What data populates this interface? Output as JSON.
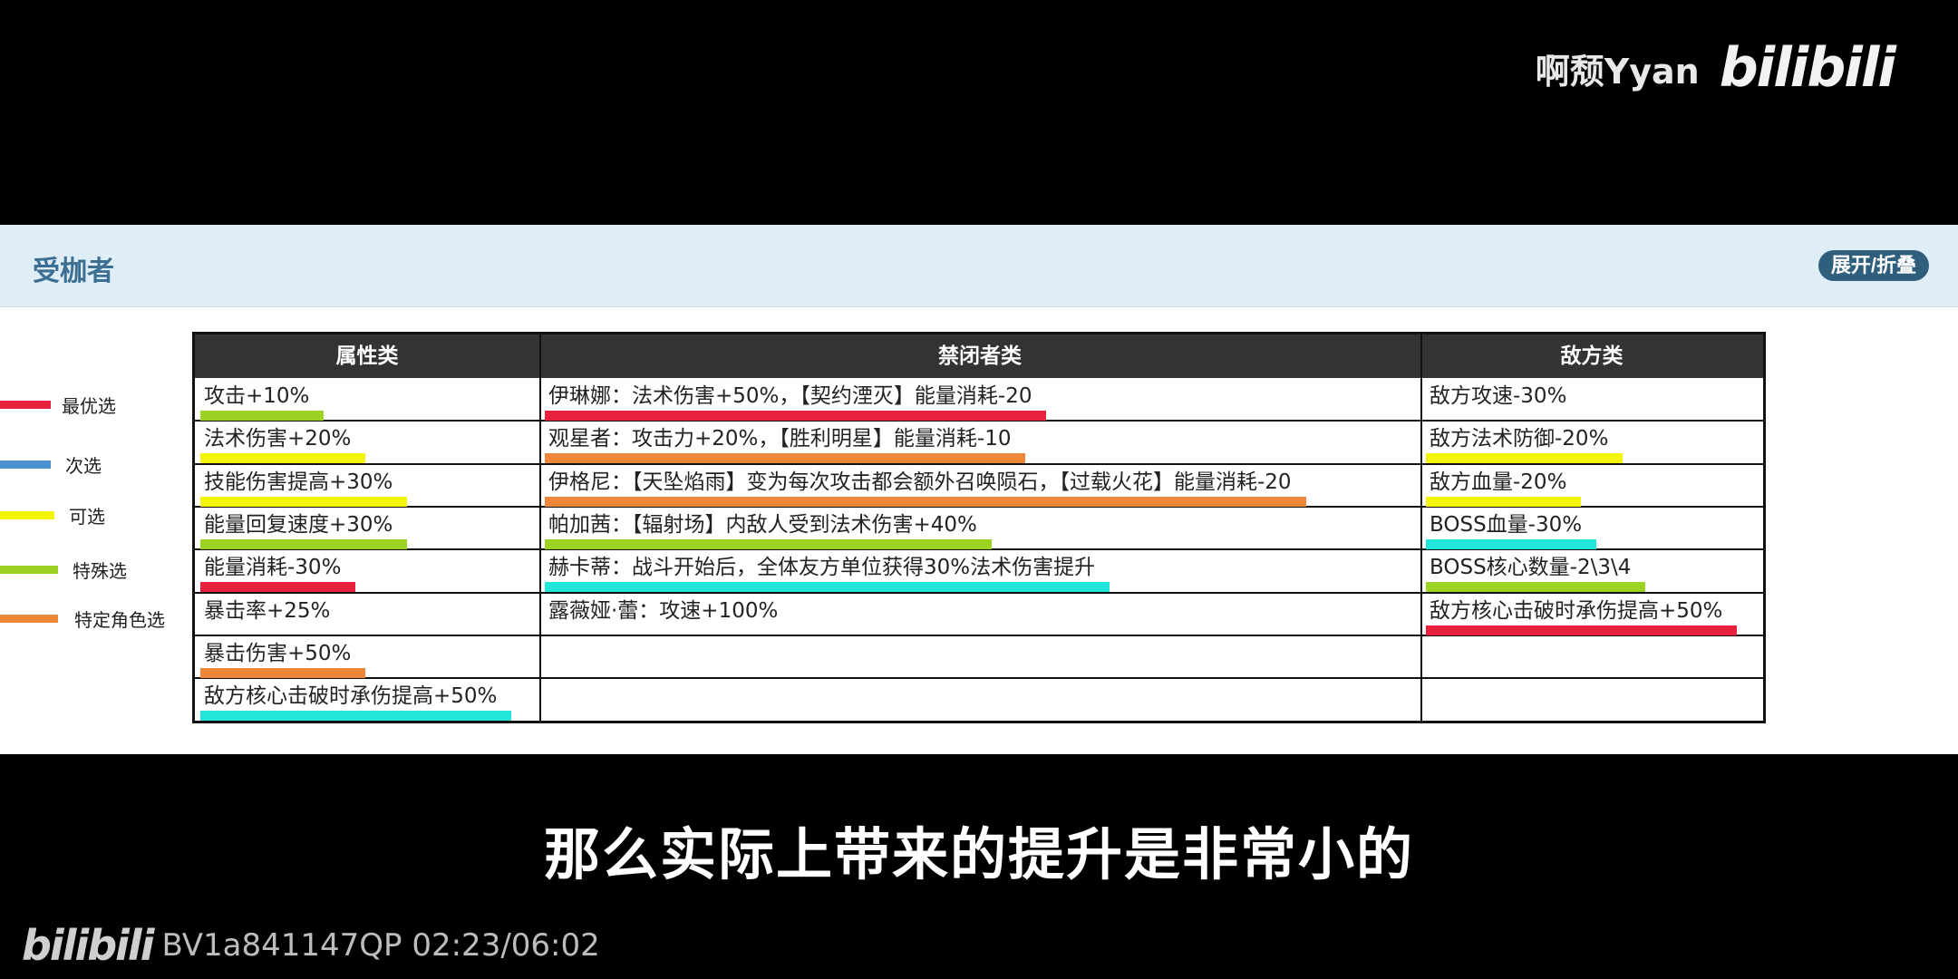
{
  "watermark": {
    "user": "啊颓Yyan",
    "logo": "bilibili"
  },
  "panel": {
    "title": "受枷者",
    "toggle_label": "展开/折叠"
  },
  "legend": [
    {
      "label": "最优选",
      "color": "#e8213d"
    },
    {
      "label": "次选",
      "color": "#4a90d0"
    },
    {
      "label": "可选",
      "color": "#f5f50a"
    },
    {
      "label": "特殊选",
      "color": "#9cd323"
    },
    {
      "label": "特定角色选",
      "color": "#ef873a"
    }
  ],
  "table": {
    "headers": [
      "属性类",
      "禁闭者类",
      "敌方类"
    ],
    "col1": [
      {
        "text": "攻击+10%",
        "color": "#9cd323"
      },
      {
        "text": "法术伤害+20%",
        "color": "#f5f50a"
      },
      {
        "text": "技能伤害提高+30%",
        "color": "#f5f50a"
      },
      {
        "text": "能量回复速度+30%",
        "color": "#9cd323"
      },
      {
        "text": "能量消耗-30%",
        "color": "#e8213d"
      },
      {
        "text": "暴击率+25%",
        "color": ""
      },
      {
        "text": "暴击伤害+50%",
        "color": "#ef873a"
      },
      {
        "text": "敌方核心击破时承伤提高+50%",
        "color": "#22e6da"
      }
    ],
    "col2": [
      {
        "text": "伊琳娜：法术伤害+50%，【契约湮灭】能量消耗-20",
        "color": "#e8213d"
      },
      {
        "text": "观星者：攻击力+20%，【胜利明星】能量消耗-10",
        "color": "#ef873a"
      },
      {
        "text": "伊格尼：【天坠焰雨】变为每次攻击都会额外召唤陨石，【过载火花】能量消耗-20",
        "color": "#ef873a"
      },
      {
        "text": "帕加茜：【辐射场】内敌人受到法术伤害+40%",
        "color": "#9cd323"
      },
      {
        "text": "赫卡蒂：战斗开始后，全体友方单位获得30%法术伤害提升",
        "color": "#22e6da"
      },
      {
        "text": "露薇娅·蕾：攻速+100%",
        "color": ""
      }
    ],
    "col3": [
      {
        "text": "敌方攻速-30%",
        "color": ""
      },
      {
        "text": "敌方法术防御-20%",
        "color": "#f5f50a"
      },
      {
        "text": "敌方血量-20%",
        "color": "#f5f50a"
      },
      {
        "text": "BOSS血量-30%",
        "color": "#22e6da"
      },
      {
        "text": "BOSS核心数量-2\\3\\4",
        "color": "#9cd323"
      },
      {
        "text": "敌方核心击破时承伤提高+50%",
        "color": "#e8213d"
      }
    ]
  },
  "subtitle": "那么实际上带来的提升是非常小的",
  "video_info": {
    "logo": "bilibili",
    "text": "BV1a841147QP 02:23/06:02"
  }
}
